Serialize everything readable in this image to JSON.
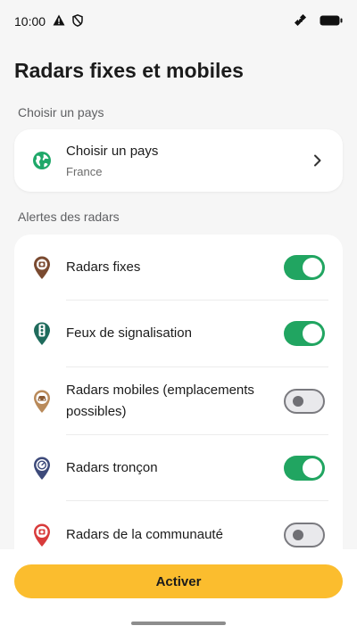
{
  "status_bar": {
    "time": "10:00"
  },
  "title": "Radars fixes et mobiles",
  "country_section": {
    "label": "Choisir un pays",
    "title": "Choisir un pays",
    "selected": "France"
  },
  "alerts_section": {
    "label": "Alertes des radars",
    "items": [
      {
        "label": "Radars fixes",
        "enabled": true,
        "icon": "fixed-radar-icon",
        "color": "#7a4a30"
      },
      {
        "label": "Feux de signalisation",
        "enabled": true,
        "icon": "traffic-light-icon",
        "color": "#1f6b5c"
      },
      {
        "label": "Radars mobiles (emplacements possibles)",
        "enabled": false,
        "icon": "mobile-radar-icon",
        "color": "#b98a5a"
      },
      {
        "label": "Radars tronçon",
        "enabled": true,
        "icon": "section-radar-icon",
        "color": "#3d4a7a"
      },
      {
        "label": "Radars de la communauté",
        "enabled": false,
        "icon": "community-radar-icon",
        "color": "#d83b3b"
      }
    ]
  },
  "activate_label": "Activer",
  "colors": {
    "accent_yellow": "#fbbd2e",
    "toggle_on": "#21a561",
    "background": "#f6f6f6"
  }
}
